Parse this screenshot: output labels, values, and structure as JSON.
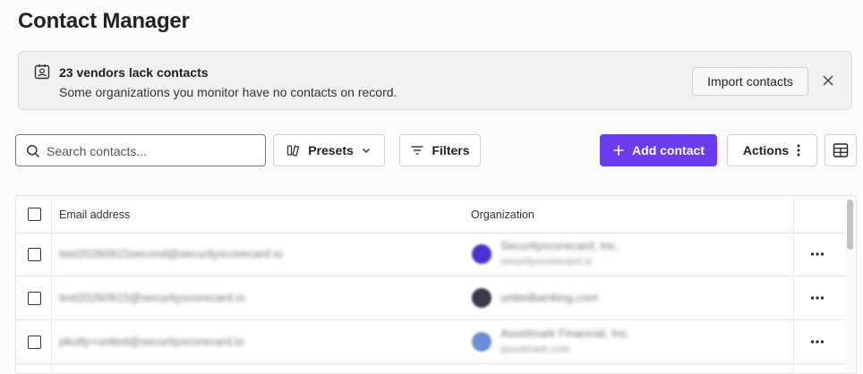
{
  "page": {
    "title": "Contact Manager"
  },
  "banner": {
    "icon": "contact-card-icon",
    "title": "23 vendors lack contacts",
    "description": "Some organizations you monitor have no contacts on record.",
    "import_label": "Import contacts",
    "close_icon": "close-icon"
  },
  "toolbar": {
    "search_placeholder": "Search contacts...",
    "presets_label": "Presets",
    "filters_label": "Filters",
    "add_label": "Add contact",
    "actions_label": "Actions",
    "accent_color": "#6a3df2"
  },
  "table": {
    "columns": [
      "Email address",
      "Organization"
    ],
    "rows": [
      {
        "email": "test20260915second@securityscorecard.io",
        "org_name": "Securityscorecard, Inc.",
        "org_domain": "securityscorecard.io",
        "logo_color": "#4b32d6"
      },
      {
        "email": "test20260915@securityscorecard.io",
        "org_name": "unitedbanking.com",
        "org_domain": "",
        "logo_color": "#3a3a4a"
      },
      {
        "email": "pkutty+united@securityscorecard.io",
        "org_name": "Assetmark Financial, Inc.",
        "org_domain": "assetmark.com",
        "logo_color": "#6b8fd6"
      }
    ]
  }
}
